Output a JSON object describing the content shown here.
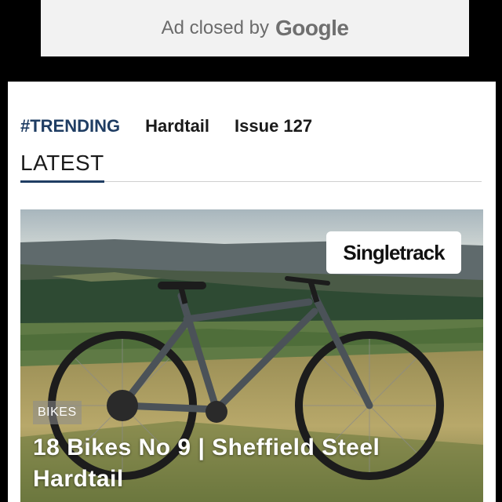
{
  "ad": {
    "text": "Ad closed by",
    "brand": "Google"
  },
  "nav": {
    "tags": [
      "#TRENDING",
      "Hardtail",
      "Issue 127"
    ]
  },
  "section": {
    "title": "LATEST"
  },
  "feature": {
    "logo_text": "Singletrack",
    "category": "BIKES",
    "headline": "18 Bikes No 9 | Sheffield Steel Hardtail"
  },
  "colors": {
    "accent": "#1f3d63"
  }
}
